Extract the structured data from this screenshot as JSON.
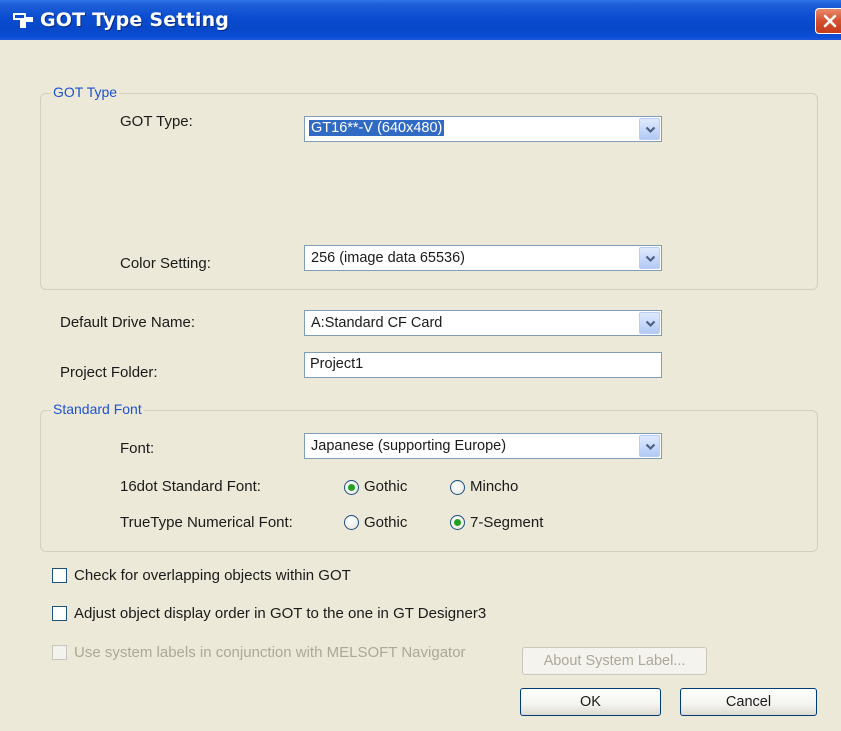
{
  "window": {
    "title": "GOT Type Setting"
  },
  "got_type_group": {
    "legend": "GOT Type",
    "got_type_label": "GOT Type:",
    "got_type_value": "GT16**-V (640x480)",
    "color_label": "Color Setting:",
    "color_value": "256 (image data 65536)"
  },
  "drive": {
    "label": "Default Drive Name:",
    "value": "A:Standard CF Card"
  },
  "project_folder": {
    "label": "Project Folder:",
    "value": "Project1"
  },
  "font_group": {
    "legend": "Standard Font",
    "font_label": "Font:",
    "font_value": "Japanese (supporting Europe)",
    "dot16_label": "16dot Standard Font:",
    "dot16_options": [
      "Gothic",
      "Mincho"
    ],
    "dot16_selected": "Gothic",
    "truetype_label": "TrueType Numerical Font:",
    "truetype_options": [
      "Gothic",
      "7-Segment"
    ],
    "truetype_selected": "7-Segment"
  },
  "checks": {
    "overlap": {
      "label": "Check for overlapping objects within GOT",
      "checked": false
    },
    "display_order": {
      "label": "Adjust object display order in GOT to the one in GT Designer3",
      "checked": false
    },
    "system_labels": {
      "label": "Use system labels in conjunction with MELSOFT Navigator",
      "checked": false,
      "enabled": false
    }
  },
  "buttons": {
    "about": "About System Label...",
    "ok": "OK",
    "cancel": "Cancel"
  },
  "icons": {
    "title": "window-icon",
    "close": "close-icon",
    "dropdown": "chevron-down-icon"
  },
  "colors": {
    "titlebar": "#0a4cd0",
    "dialog_bg": "#ece9d8",
    "legend_text": "#1d52d0",
    "selection": "#316ac5",
    "close_button": "#d4502e"
  }
}
